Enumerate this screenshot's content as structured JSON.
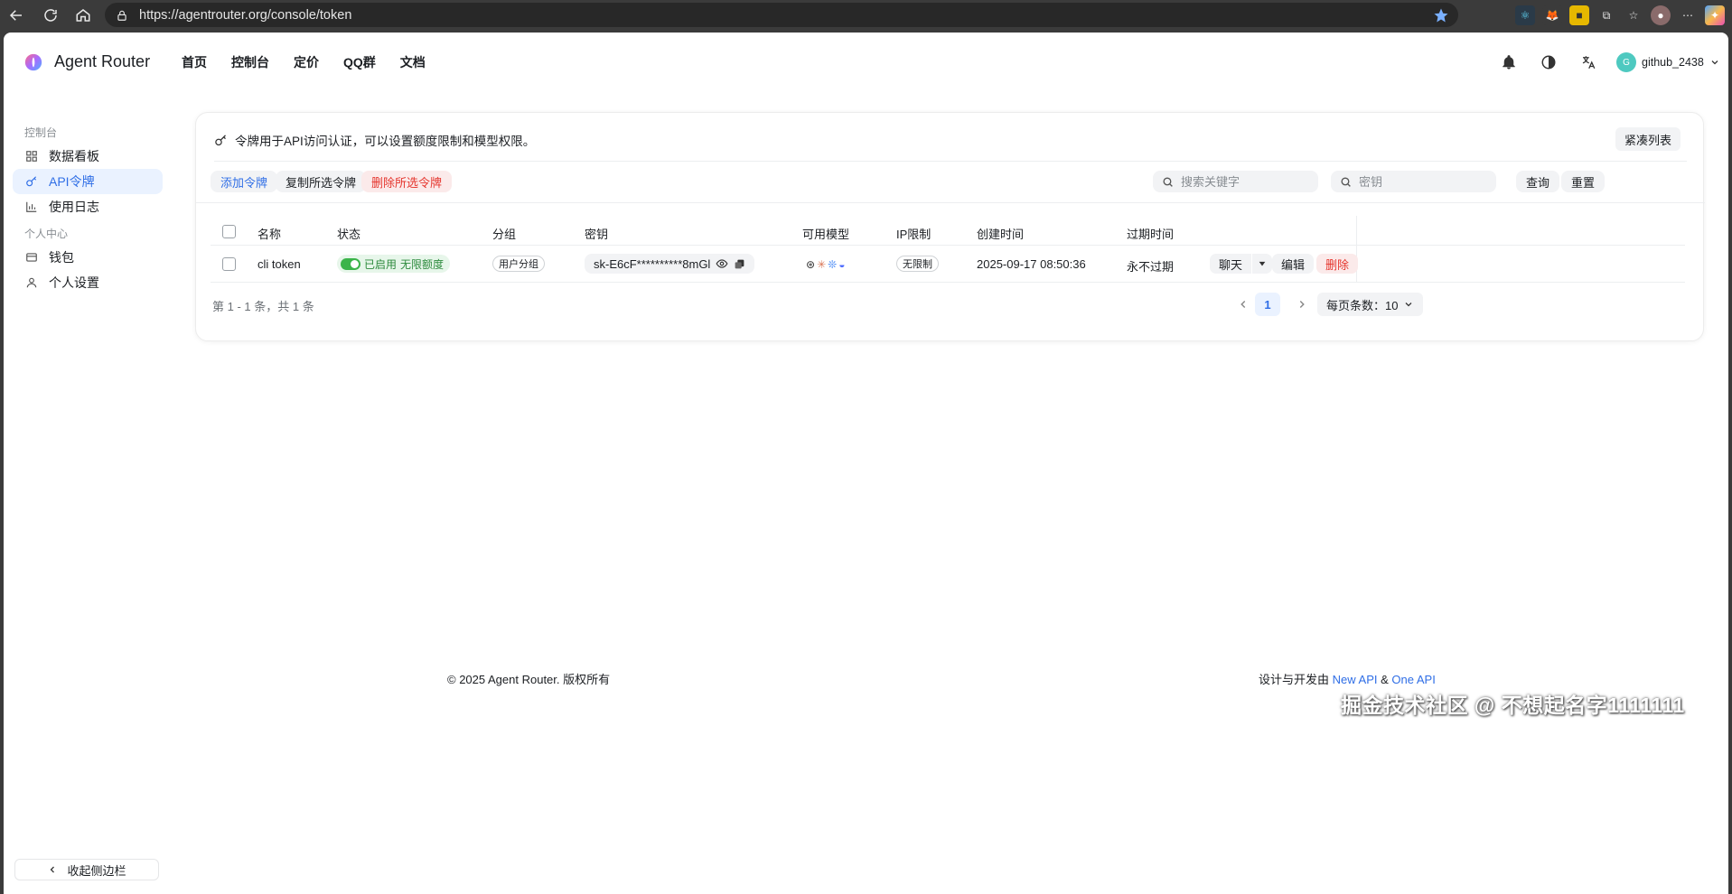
{
  "browser": {
    "url": "https://agentrouter.org/console/token"
  },
  "header": {
    "brand": "Agent Router",
    "nav": [
      "首页",
      "控制台",
      "定价",
      "QQ群",
      "文档"
    ],
    "username": "github_2438",
    "avatar_letter": "G"
  },
  "sidebar": {
    "group1": "控制台",
    "group2": "个人中心",
    "items": [
      {
        "label": "数据看板",
        "icon": "dashboard-icon"
      },
      {
        "label": "API令牌",
        "icon": "key-icon"
      },
      {
        "label": "使用日志",
        "icon": "bar-chart-icon"
      },
      {
        "label": "钱包",
        "icon": "wallet-icon"
      },
      {
        "label": "个人设置",
        "icon": "user-icon"
      }
    ],
    "collapse_label": "收起侧边栏"
  },
  "card": {
    "info": "令牌用于API访问认证，可以设置额度限制和模型权限。",
    "compact_label": "紧凑列表",
    "add_label": "添加令牌",
    "copy_label": "复制所选令牌",
    "delete_label": "删除所选令牌",
    "search_placeholder": "搜索关键字",
    "key_placeholder": "密钥",
    "query_label": "查询",
    "reset_label": "重置"
  },
  "table": {
    "columns": [
      "名称",
      "状态",
      "分组",
      "密钥",
      "可用模型",
      "IP限制",
      "创建时间",
      "过期时间"
    ],
    "rows": [
      {
        "name": "cli token",
        "status": "已启用",
        "quota": "无限额度",
        "group": "用户分组",
        "key": "sk-E6cF**********8mGl",
        "ip_limit": "无限制",
        "created": "2025-09-17 08:50:36",
        "expires": "永不过期",
        "chat_label": "聊天",
        "edit_label": "编辑",
        "delete_label": "删除"
      }
    ]
  },
  "pagination": {
    "summary": "第 1 - 1 条，共 1 条",
    "current_page": "1",
    "per_page": "每页条数：10"
  },
  "footer": {
    "copyright": "© 2025 Agent Router. 版权所有",
    "designed_prefix": "设计与开发由 ",
    "link1": "New API",
    "amp": " & ",
    "link2": "One API"
  },
  "watermark": "掘金技术社区 @ 不想起名字1111111",
  "colors": {
    "accent": "#2f6ee6",
    "danger": "#e5352d",
    "success": "#3bb44a"
  }
}
